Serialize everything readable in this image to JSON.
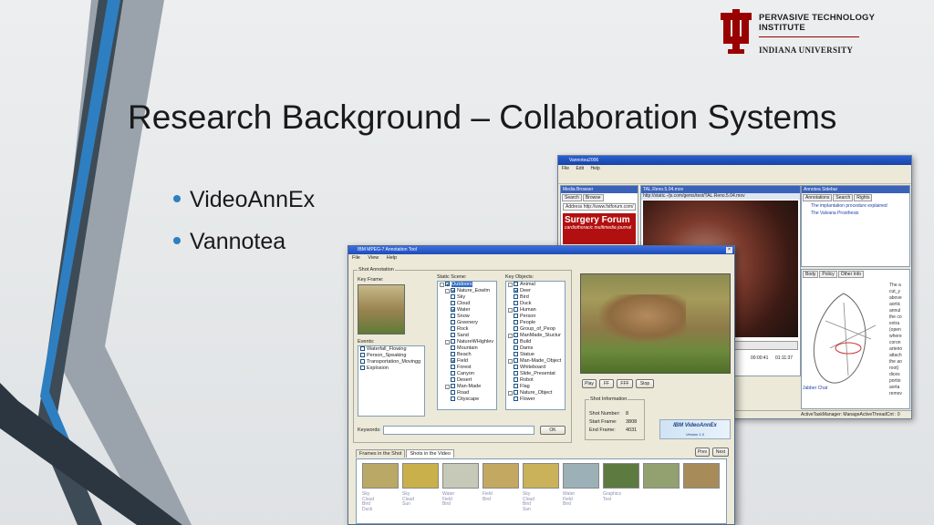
{
  "logo": {
    "line1": "PERVASIVE TECHNOLOGY",
    "line2": "INSTITUTE",
    "line3": "INDIANA UNIVERSITY",
    "brand_color": "#990000"
  },
  "slide": {
    "title": "Research Background – Collaboration Systems",
    "bullets": [
      "VideoAnnEx",
      "Vannotea"
    ],
    "bullet_color": "#2e7fc1"
  },
  "vannotea": {
    "title": "Vannotea2006",
    "menus": [
      "File",
      "Edit",
      "Help"
    ],
    "media_browser": {
      "header": "Media Browser",
      "tabs": [
        "Search",
        "Browse"
      ],
      "address_label": "Address",
      "address_value": "http://www.fstforum.com/"
    },
    "ad": {
      "headline": "Surgery Forum",
      "subline": "cardiothoracic multimedia journal"
    },
    "video": {
      "header": "TAL.Reno.5.04.mov",
      "url": "http://static.-/js.com/gems/test/TAL.Reno.5.04.mov",
      "time_a": "00:00:41",
      "time_b": "01:11:37"
    },
    "annotation_sidebar": {
      "header": "Annotea Sidebar",
      "tabs": [
        "Annotations",
        "Search",
        "Rights"
      ],
      "items": [
        "The implantation procedure explained",
        "The Valvana Prosthesis"
      ]
    },
    "body_tabs": [
      "Body",
      "Policy",
      "Other Info"
    ],
    "body_text": "The a cut_y above aortic annul the co extra (open where coron arterio attach the ao root) dices portio aorta remov",
    "chat": "Jabber Chat",
    "status": "ActiveTaskManager: ManageActiveThreadCnt : 0 remaining"
  },
  "videoannex": {
    "title": "IBM MPEG-7 Annotation Tool",
    "menus": [
      "File",
      "View",
      "Help"
    ],
    "shot_annotation_label": "Shot Annotation",
    "key_frame_label": "Key Frame:",
    "events_label": "Events:",
    "events": [
      {
        "label": "Waterfall_Flowing",
        "checked": false
      },
      {
        "label": "Person_Speaking",
        "checked": false
      },
      {
        "label": "Transportation_Movingg",
        "checked": false
      },
      {
        "label": "Explosion",
        "checked": false
      }
    ],
    "static_scene_label": "Static Scene:",
    "static_scene": [
      {
        "label": "Outdoors",
        "level": 0,
        "checked": true,
        "selected": true,
        "expander": "-"
      },
      {
        "label": "Nature_Eowlm",
        "level": 1,
        "checked": true,
        "expander": "-"
      },
      {
        "label": "Sky",
        "level": 2,
        "checked": false
      },
      {
        "label": "Cloud",
        "level": 2,
        "checked": false
      },
      {
        "label": "Water",
        "level": 2,
        "checked": true
      },
      {
        "label": "Snow",
        "level": 2,
        "checked": false
      },
      {
        "label": "Greenery",
        "level": 2,
        "checked": false
      },
      {
        "label": "Rock",
        "level": 2,
        "checked": false
      },
      {
        "label": "Sand",
        "level": 2,
        "checked": false
      },
      {
        "label": "NatureWHighlev",
        "level": 1,
        "checked": false,
        "expander": "-"
      },
      {
        "label": "Mountain",
        "level": 2,
        "checked": false
      },
      {
        "label": "Beach",
        "level": 2,
        "checked": false
      },
      {
        "label": "Field",
        "level": 2,
        "checked": true
      },
      {
        "label": "Forest",
        "level": 2,
        "checked": false
      },
      {
        "label": "Canyon",
        "level": 2,
        "checked": false
      },
      {
        "label": "Desert",
        "level": 2,
        "checked": false
      },
      {
        "label": "Man-Made",
        "level": 1,
        "checked": false,
        "expander": "-"
      },
      {
        "label": "Road",
        "level": 2,
        "checked": false
      },
      {
        "label": "Cityscape",
        "level": 2,
        "checked": false
      }
    ],
    "key_objects_label": "Key Objects:",
    "key_objects": [
      {
        "label": "Animal",
        "level": 0,
        "checked": false,
        "expander": "-"
      },
      {
        "label": "Deer",
        "level": 1,
        "checked": true
      },
      {
        "label": "Bird",
        "level": 1,
        "checked": false
      },
      {
        "label": "Duck",
        "level": 1,
        "checked": false
      },
      {
        "label": "Human",
        "level": 0,
        "checked": false,
        "expander": "-"
      },
      {
        "label": "Person",
        "level": 1,
        "checked": false
      },
      {
        "label": "People",
        "level": 1,
        "checked": false
      },
      {
        "label": "Group_of_Peop",
        "level": 1,
        "checked": false
      },
      {
        "label": "ManMade_Stuctur",
        "level": 0,
        "checked": false,
        "expander": "-"
      },
      {
        "label": "Build",
        "level": 1,
        "checked": false
      },
      {
        "label": "Dams",
        "level": 1,
        "checked": false
      },
      {
        "label": "Statue",
        "level": 1,
        "checked": false
      },
      {
        "label": "Man-Made_Object",
        "level": 0,
        "checked": false,
        "expander": "-"
      },
      {
        "label": "Whiteboard",
        "level": 1,
        "checked": false
      },
      {
        "label": "Slide_Presentat",
        "level": 1,
        "checked": false
      },
      {
        "label": "Robot",
        "level": 1,
        "checked": false
      },
      {
        "label": "Flag",
        "level": 1,
        "checked": false
      },
      {
        "label": "Nature_Object",
        "level": 0,
        "checked": false,
        "expander": "-"
      },
      {
        "label": "Flower",
        "level": 1,
        "checked": false
      }
    ],
    "player_buttons": [
      "Play",
      "FF",
      "FFF",
      "Stop"
    ],
    "shot_info": {
      "label": "Shot Information",
      "shot_number_label": "Shot Number:",
      "shot_number": "8",
      "start_frame_label": "Start Frame:",
      "start_frame": "3808",
      "end_frame_label": "End Frame:",
      "end_frame": "4031"
    },
    "keywords_label": "Keywords:",
    "keywords_value": "",
    "ok_label": "OK",
    "ibm_logo": "IBM VideoAnnEx",
    "ibm_logo_sub": "Version 1.0",
    "frame_tabs": [
      "Frames in the Shot",
      "Shots in the Video"
    ],
    "prev_label": "Prev",
    "next_label": "Next",
    "thumbnails": [
      {
        "caption": "Sky\nCloud\nBird\nDuck",
        "color": "#b9a866"
      },
      {
        "caption": "Sky\nCloud\nSun",
        "color": "#c9b04a"
      },
      {
        "caption": "Water\nField\nBird",
        "color": "#c6c9b8"
      },
      {
        "caption": "Field\nBird",
        "color": "#c3a862"
      },
      {
        "caption": "Sky\nCloud\nBird\nSun",
        "color": "#c9b25a"
      },
      {
        "caption": "Water\nField\nBird",
        "color": "#9cb0b8"
      },
      {
        "caption": "Graphics\nText",
        "color": "#5d7a40"
      },
      {
        "caption": "",
        "color": "#93a070"
      },
      {
        "caption": "",
        "color": "#a78c5a"
      }
    ]
  }
}
